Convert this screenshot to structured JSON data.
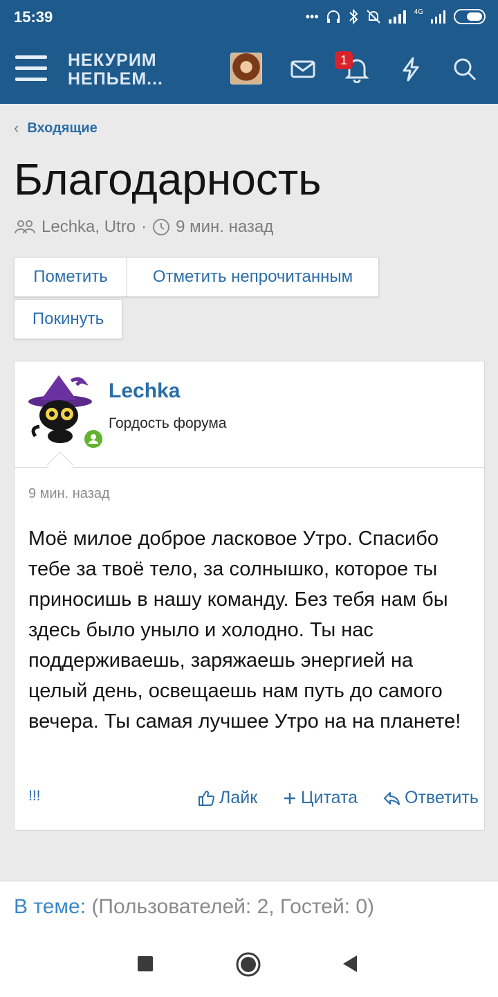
{
  "status": {
    "time": "15:39",
    "icons": [
      "dots-icon",
      "headphones-icon",
      "bluetooth-icon",
      "silent-icon",
      "signal-icon",
      "4g-signal-icon",
      "battery-icon"
    ],
    "network_label": "4G"
  },
  "header": {
    "logo_line1": "НЕКУРИМ",
    "logo_line2": "НЕПЬЕМ...",
    "notification_count": "1",
    "brand_color": "#1e5a8c"
  },
  "breadcrumb": {
    "label": "Входящие"
  },
  "page": {
    "title": "Благодарность",
    "participants": "Lechka, Utro",
    "separator": "·",
    "time_ago": "9 мин. назад"
  },
  "buttons": {
    "mark": "Пометить",
    "mark_unread": "Отметить непрочитанным",
    "leave": "Покинуть"
  },
  "post": {
    "username": "Lechka",
    "user_title": "Гордость форума",
    "time": "9 мин. назад",
    "body": "Моё милое доброе ласковое Утро. Спасибо тебе за твоё тело, за солнышко, которое ты приносишь в нашу команду. Без тебя нам бы здесь было уныло и холодно. Ты нас поддерживаешь, заряжаешь энергией на целый день, освещаешь нам путь до самого вечера. Ты самая лучшее Утро на на планете!",
    "report": "!!!",
    "like": "Лайк",
    "quote": "Цитата",
    "reply": "Ответить"
  },
  "footer": {
    "in_topic_label": "В теме:",
    "in_topic_value": "(Пользователей: 2, Гостей: 0)"
  },
  "colors": {
    "link": "#2b6da8",
    "online": "#63b42f",
    "badge": "#d8232a"
  }
}
